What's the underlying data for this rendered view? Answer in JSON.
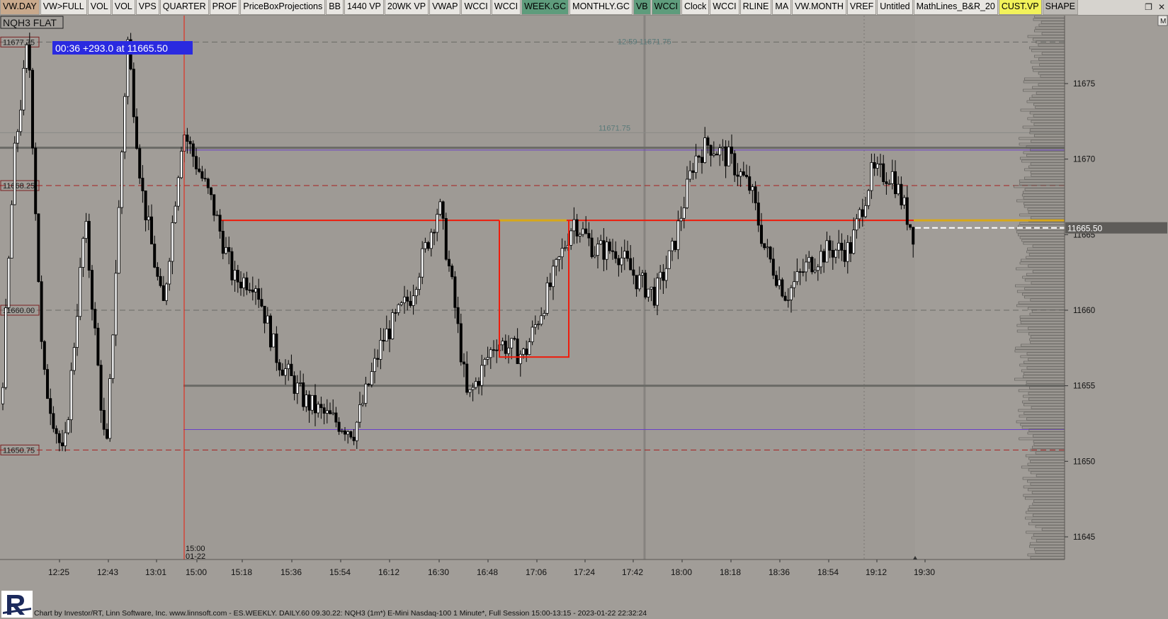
{
  "toolbar": {
    "tabs": [
      {
        "label": "VW.DAY",
        "bg": "#c9a98c"
      },
      {
        "label": "VW>FULL",
        "bg": "#e8e6e2"
      },
      {
        "label": "VOL",
        "bg": "#e8e6e2"
      },
      {
        "label": "VOL",
        "bg": "#e8e6e2"
      },
      {
        "label": "VPS",
        "bg": "#e8e6e2"
      },
      {
        "label": "QUARTER",
        "bg": "#e8e6e2"
      },
      {
        "label": "PROF",
        "bg": "#e8e6e2"
      },
      {
        "label": "PriceBoxProjections",
        "bg": "#e8e6e2"
      },
      {
        "label": "BB",
        "bg": "#e8e6e2"
      },
      {
        "label": "1440 VP",
        "bg": "#e8e6e2"
      },
      {
        "label": "20WK VP",
        "bg": "#e8e6e2"
      },
      {
        "label": "VWAP",
        "bg": "#e8e6e2"
      },
      {
        "label": "WCCI",
        "bg": "#e8e6e2"
      },
      {
        "label": "WCCI",
        "bg": "#e8e6e2"
      },
      {
        "label": "WEEK.GC",
        "bg": "#5e9c7c"
      },
      {
        "label": "MONTHLY.GC",
        "bg": "#e8e6e2"
      },
      {
        "label": "VB",
        "bg": "#5e9c7c"
      },
      {
        "label": "WCCI",
        "bg": "#5e9c7c"
      },
      {
        "label": "Clock",
        "bg": "#e8e6e2"
      },
      {
        "label": "WCCI",
        "bg": "#e8e6e2"
      },
      {
        "label": "RLINE",
        "bg": "#e8e6e2"
      },
      {
        "label": "MA",
        "bg": "#e8e6e2"
      },
      {
        "label": "VW.MONTH",
        "bg": "#e8e6e2"
      },
      {
        "label": "VREF",
        "bg": "#e8e6e2"
      },
      {
        "label": "Untitled",
        "bg": "#e8e6e2"
      },
      {
        "label": "MathLines_B&R_20",
        "bg": "#e8e6e2"
      },
      {
        "label": "CUST.VP",
        "bg": "#f2f25a"
      },
      {
        "label": "SHAPE",
        "bg": "#bdbab5"
      }
    ],
    "window_controls": [
      "restore-icon",
      "close-icon"
    ]
  },
  "colors": {
    "background": "#a19d98",
    "session_area": "#9e9a95",
    "candle_up": "#ffffff",
    "candle_down": "#000000",
    "red_line": "#ee1c0c",
    "gold_line": "#d8a818",
    "purple_line": "#6a40c8",
    "grey_line": "#6a6a66",
    "price_tag": "#2a2ae0"
  },
  "chart_data": {
    "type": "candlestick",
    "symbol_label": "NQH3 FLAT",
    "info_box": "00:36  +293.0 at 11665.50",
    "ylim": [
      11643.5,
      11679.5
    ],
    "price_axis_ticks": [
      "11675",
      "11670",
      "11665",
      "11660",
      "11655",
      "11650",
      "11645"
    ],
    "time_axis_ticks": [
      "12:25",
      "12:43",
      "13:01",
      "15:00",
      "15:18",
      "15:36",
      "15:54",
      "16:12",
      "16:30",
      "16:48",
      "17:06",
      "17:24",
      "17:42",
      "18:00",
      "18:18",
      "18:36",
      "18:54",
      "19:12",
      "19:30"
    ],
    "session_start_label": [
      "15:00",
      "01-22"
    ],
    "last_price_tag": "11665.50",
    "corner_label": "M",
    "horizontal_levels": [
      {
        "price": 11677.75,
        "style": "dashed",
        "color": "#6a6a66",
        "label": "11677.75",
        "label_side": "left"
      },
      {
        "price": 11671.75,
        "style": "solid",
        "color": "#8a8a86",
        "label": "11671.75",
        "label_side": "center"
      },
      {
        "price": 11670.75,
        "style": "solid",
        "color": "#6a6a66",
        "label": "",
        "label_side": "none"
      },
      {
        "price": 11670.6,
        "style": "solid",
        "color": "#6a40c8",
        "label": "",
        "label_side": "none"
      },
      {
        "price": 11668.25,
        "style": "dashed",
        "color": "#a82020",
        "label": "11668.25",
        "label_side": "left"
      },
      {
        "price": 11665.95,
        "style": "solid",
        "color": "#ee1c0c",
        "label": "",
        "label_side": "none"
      },
      {
        "price": 11660,
        "style": "dashed",
        "color": "#6a6a66",
        "label": "11660.00",
        "label_side": "left"
      },
      {
        "price": 11655,
        "style": "solid",
        "color": "#6a6a66",
        "label": "",
        "label_side": "none"
      },
      {
        "price": 11652.1,
        "style": "solid",
        "color": "#6a40c8",
        "label": "",
        "label_side": "none"
      },
      {
        "price": 11650.75,
        "style": "dashed",
        "color": "#a82020",
        "label": "11650.75",
        "label_side": "left"
      }
    ],
    "top_annotation": "12:59 11671.75",
    "ohlc": []
  },
  "footer": {
    "text": "Chart by Investor/RT, Linn Software, Inc. www.linnsoft.com - ES.WEEKLY. DAILY.60     09.30.22: NQH3 (1m*) E-Mini Nasdaq-100 1 Minute*, Full Session 15:00-13:15 - 2023-01-22 22:32:24"
  }
}
